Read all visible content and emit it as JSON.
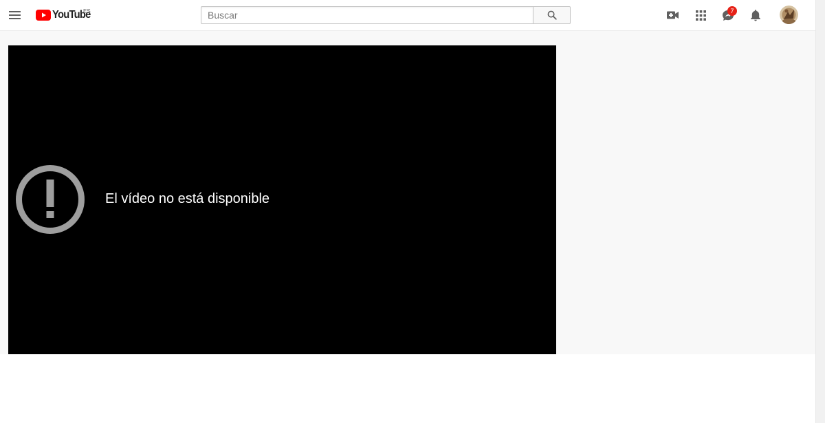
{
  "header": {
    "logo_text": "YouTube",
    "region_code": "ES",
    "search": {
      "placeholder": "Buscar",
      "value": ""
    },
    "icons": {
      "menu": "hamburger-menu-icon",
      "search": "search-icon",
      "upload": "video-camera-plus-icon",
      "apps": "apps-grid-icon",
      "messages": "chat-share-icon",
      "notifications": "bell-icon"
    },
    "messages_badge": "7"
  },
  "player": {
    "error_message": "El vídeo no está disponible",
    "error_icon": "exclamation-circle-icon"
  },
  "colors": {
    "brand_red": "#ff0000",
    "badge_red": "#e62117",
    "icon_gray": "#606060",
    "player_bg": "#000000",
    "error_icon_gray": "#9e9e9e"
  }
}
